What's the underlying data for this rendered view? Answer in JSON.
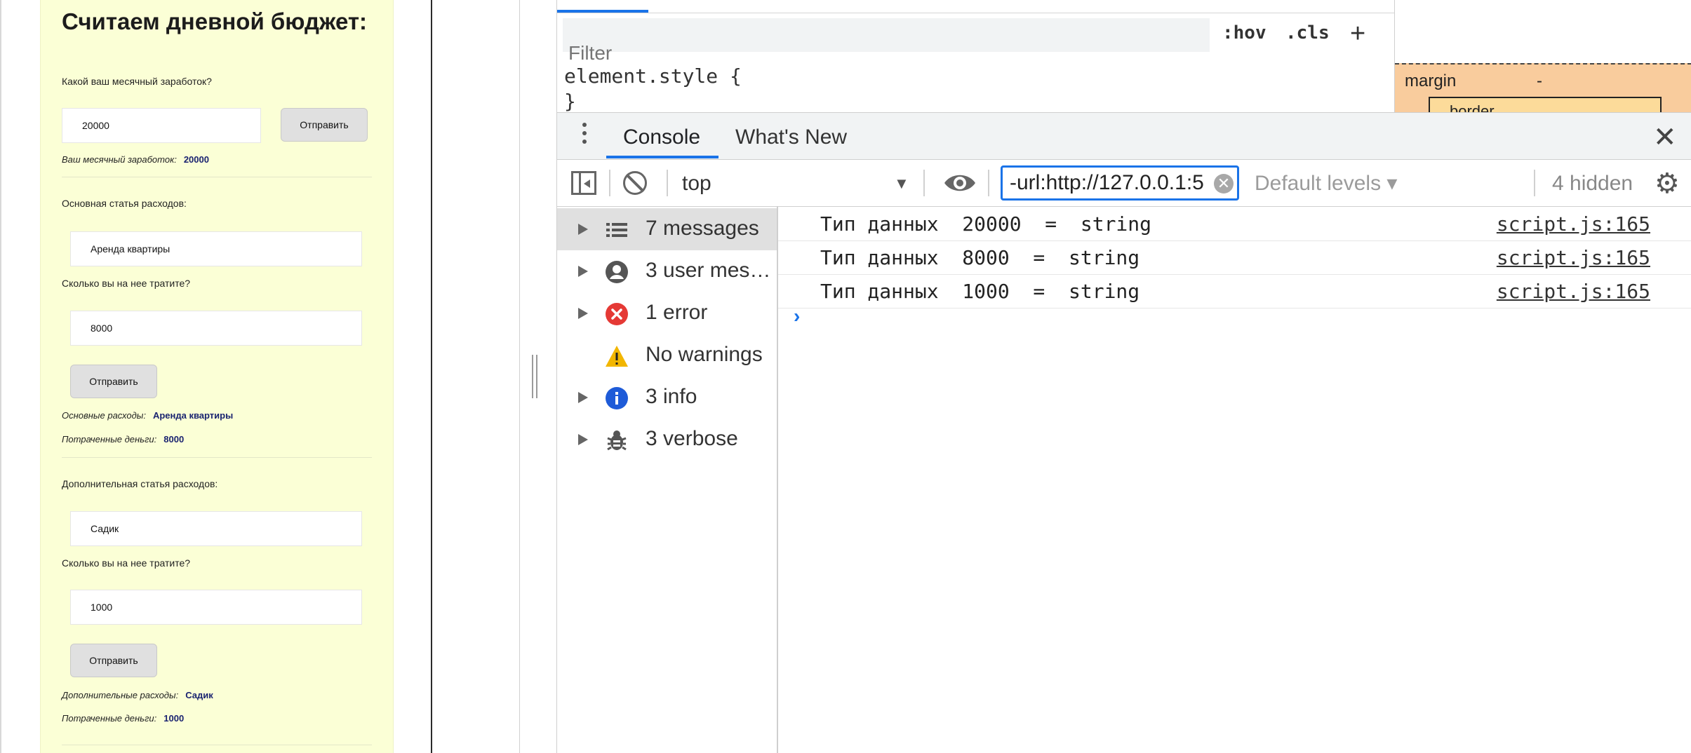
{
  "preview": {
    "title": "Считаем дневной бюджет:",
    "income_question": "Какой ваш месячный заработок?",
    "income_value": "20000",
    "income_submit": "Отправить",
    "income_result_label": "Ваш месячный заработок:",
    "income_result_value": "20000",
    "main_expense_question": "Основная статья расходов:",
    "main_expense_value": "Аренда квартиры",
    "main_spend_question": "Сколько вы на нее тратите?",
    "main_spend_value": "8000",
    "main_submit": "Отправить",
    "main_result_label": "Основные расходы:",
    "main_result_value": "Аренда квартиры",
    "main_spent_label": "Потраченные деньги:",
    "main_spent_value": "8000",
    "extra_expense_question": "Дополнительная статья расходов:",
    "extra_expense_value": "Садик",
    "extra_spend_question": "Сколько вы на нее тратите?",
    "extra_spend_value": "1000",
    "extra_submit": "Отправить",
    "extra_result_label": "Дополнительные расходы:",
    "extra_result_value": "Садик",
    "extra_spent_label": "Потраченные деньги:",
    "extra_spent_value": "1000"
  },
  "styles": {
    "filter_placeholder": "Filter",
    "hov": ":hov",
    "cls": ".cls",
    "plus": "+",
    "rule_open": "element.style {",
    "rule_close": "}",
    "box_margin_label": "margin",
    "box_margin_value": "-",
    "box_border_label": "border"
  },
  "drawer": {
    "tabs": [
      "Console",
      "What's New"
    ],
    "active_tab": "Console",
    "close": "✕"
  },
  "toolbar": {
    "context": "top",
    "url_filter_value": "-url:http://127.0.0.1:5",
    "levels": "Default levels ▾",
    "hidden": "4 hidden"
  },
  "sidebar": {
    "items": [
      {
        "label": "7 messages",
        "icon": "list-icon",
        "expandable": true,
        "selected": true
      },
      {
        "label": "3 user mes…",
        "icon": "user-icon",
        "expandable": true,
        "selected": false
      },
      {
        "label": "1 error",
        "icon": "error-icon",
        "expandable": true,
        "selected": false
      },
      {
        "label": "No warnings",
        "icon": "warning-icon",
        "expandable": false,
        "selected": false
      },
      {
        "label": "3 info",
        "icon": "info-icon",
        "expandable": true,
        "selected": false
      },
      {
        "label": "3 verbose",
        "icon": "bug-icon",
        "expandable": true,
        "selected": false
      }
    ]
  },
  "logs": [
    {
      "message": "Тип данных  20000  =  string",
      "source": "script.js:165"
    },
    {
      "message": "Тип данных  8000  =  string",
      "source": "script.js:165"
    },
    {
      "message": "Тип данных  1000  =  string",
      "source": "script.js:165"
    }
  ],
  "colors": {
    "accent": "#1a73e8",
    "card_bg": "#fbffd6",
    "margin_box": "#f9cc9d",
    "error": "#e53935",
    "warning": "#f2b600",
    "info": "#1e5bd8"
  }
}
